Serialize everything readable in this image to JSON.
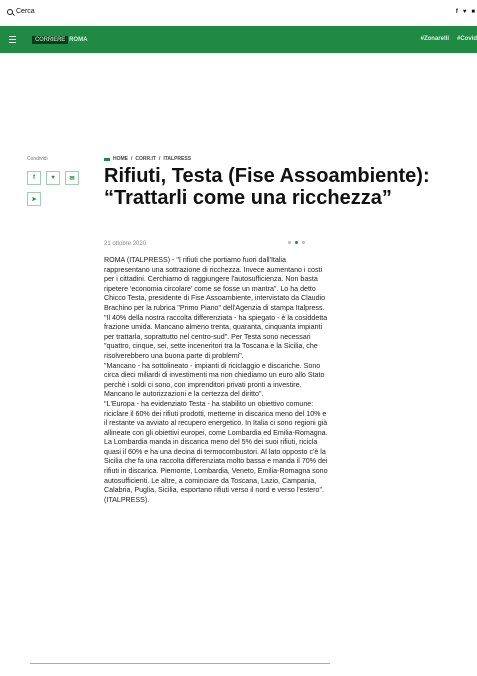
{
  "topbar": {
    "search_label": "Cerca",
    "social": [
      "f",
      "♥",
      "■"
    ]
  },
  "navbar": {
    "logo_main": "CORRIERE",
    "logo_suffix": "ROMA",
    "hashtags": [
      "#Zonarelli",
      "#Covid"
    ],
    "color": "#1f8a43"
  },
  "sidebar": {
    "share_label": "Condividi"
  },
  "article": {
    "breadcrumb": [
      "HOME",
      "CORR.IT",
      "ITALPRESS"
    ],
    "title": "Rifiuti, Testa (Fise Assoambiente): “Trattarli come una ricchezza”",
    "date": "21 ottobre 2020",
    "paragraphs": [
      "ROMA (ITALPRESS) - \"I rifiuti che portiamo fuori dall'Italia rappresentano una sottrazione di ricchezza. Invece aumentano i costi per i cittadini. Cerchiamo di raggiungere l'autosufficienza. Non basta ripetere 'economia circolare' come se fosse un mantra\". Lo ha detto Chicco Testa, presidente di Fise Assoambiente, intervistato da Claudio Brachino per la rubrica \"Primo Piano\" dell'Agenzia di stampa Italpress.",
      "\"Il 40% della nostra raccolta differenziata - ha spiegato - è la cosiddetta frazione umida. Mancano almeno trenta, quaranta, cinquanta impianti per trattarla, soprattutto nel centro-sud\". Per Testa sono necessari \"quattro, cinque, sei, sette inceneritori tra la Toscana e la Sicilia, che risolverebbero una buona parte di problemi\".",
      "\"Mancano - ha sottolineato - impianti di riciclaggio e discariche. Sono circa dieci miliardi di investimenti ma non chiediamo un euro allo Stato perchè i soldi ci sono, con imprenditori privati pronti a investire. Mancano le autorizzazioni e la certezza del diritto\".",
      "\"L'Europa - ha evidenziato Testa - ha stabilito un obiettivo comune: riciclare il 60% dei rifiuti prodotti, metterne in discarica meno del 10% e il restante va avviato al recupero energetico. In Italia ci sono regioni già allineate con gli obiettivi europei, come Lombardia ed Emilia-Romagna. La Lombardia manda in discarica meno del 5% dei suoi rifiuti, ricicla quasi il 60% e ha una decina di termocombustori. Al lato opposto c'è la Sicilia che fa una raccolta differenziata molto bassa e manda il 70% dei rifiuti in discarica. Piemonte, Lombardia, Veneto, Emilia-Romagna sono autosufficienti. Le altre, a cominciare da Toscana, Lazio, Campania, Calabria, Puglia, Sicilia, esportano rifiuti verso il nord e verso l'estero\".",
      "(ITALPRESS)."
    ]
  }
}
